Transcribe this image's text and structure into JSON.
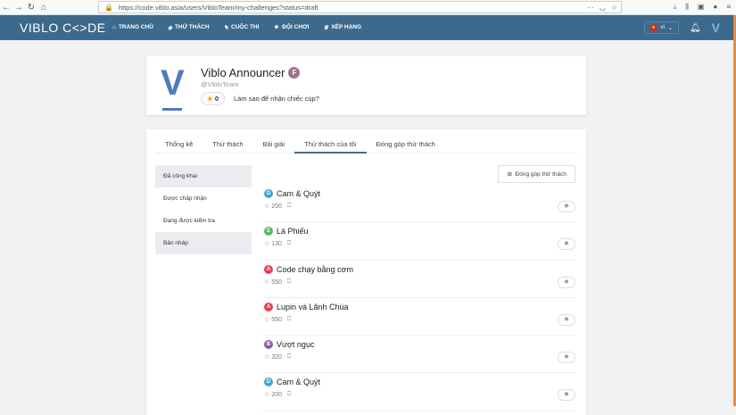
{
  "browser": {
    "url": "https://code.viblo.asia/users/VibloTeam/my-challenges?status=draft"
  },
  "nav": {
    "logo": "VIBLO C<>DE",
    "items": [
      {
        "icon": "home-icon",
        "glyph": "⌂",
        "label": "TRANG CHỦ"
      },
      {
        "icon": "puzzle-icon",
        "glyph": "◈",
        "label": "THỬ THÁCH"
      },
      {
        "icon": "contest-icon",
        "glyph": "✎",
        "label": "CUỘC THI"
      },
      {
        "icon": "team-icon",
        "glyph": "☻",
        "label": "ĐỘI CHƠI"
      },
      {
        "icon": "trophy-icon",
        "glyph": "♕",
        "label": "XẾP HẠNG"
      }
    ],
    "lang": "vi"
  },
  "profile": {
    "name": "Viblo Announcer",
    "badge": "F",
    "handle": "@VibloTeam",
    "cups": "0",
    "cup_help": "Làm sao để nhận chiếc cúp?"
  },
  "tabs": [
    "Thống kê",
    "Thử thách",
    "Bài giải",
    "Thử thách của tôi",
    "Đóng góp thử thách"
  ],
  "sidebar": [
    "Đã công khai",
    "Được chấp nhận",
    "Đang được kiểm tra",
    "Bản nháp"
  ],
  "contribute_button": "Đóng góp thử thách",
  "challenges": [
    {
      "level": "D",
      "color": "#3ba7d6",
      "title": "Cam & Quýt",
      "points": "200"
    },
    {
      "level": "E",
      "color": "#5cb85c",
      "title": "Lá Phiếu",
      "points": "130"
    },
    {
      "level": "A",
      "color": "#e8414c",
      "title": "Code chạy bằng cơm",
      "points": "550"
    },
    {
      "level": "A",
      "color": "#e8414c",
      "title": "Lupin và Lãnh Chúa",
      "points": "550"
    },
    {
      "level": "B",
      "color": "#8e5aa8",
      "title": "Vượt ngục",
      "points": "320"
    },
    {
      "level": "D",
      "color": "#3ba7d6",
      "title": "Cam & Quýt",
      "points": "200"
    }
  ]
}
